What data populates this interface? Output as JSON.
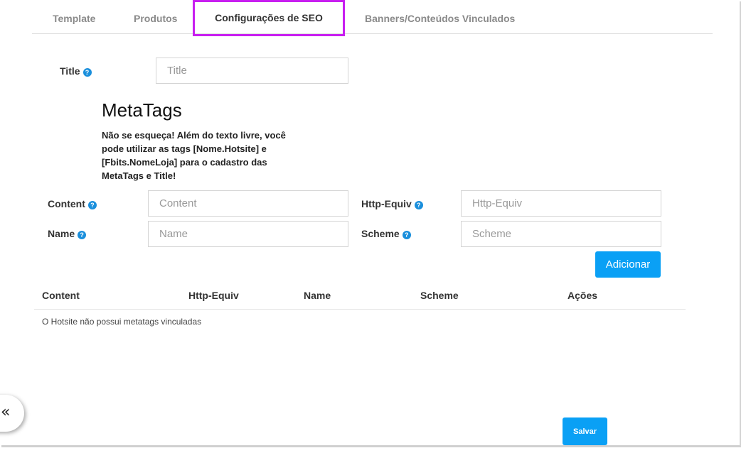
{
  "tabs": [
    {
      "label": "Template"
    },
    {
      "label": "Produtos"
    },
    {
      "label": "Configurações de SEO"
    },
    {
      "label": "Banners/Conteúdos Vinculados"
    }
  ],
  "active_tab_color": "#c81ef0",
  "title_field": {
    "label": "Title",
    "placeholder": "Title",
    "value": ""
  },
  "metatags": {
    "heading": "MetaTags",
    "note": "Não se esqueça! Além do texto livre, você pode utilizar as tags [Nome.Hotsite] e [Fbits.NomeLoja] para o cadastro das MetaTags e Title!"
  },
  "fields": {
    "content": {
      "label": "Content",
      "placeholder": "Content",
      "value": ""
    },
    "http_equiv": {
      "label": "Http-Equiv",
      "placeholder": "Http-Equiv",
      "value": ""
    },
    "name": {
      "label": "Name",
      "placeholder": "Name",
      "value": ""
    },
    "scheme": {
      "label": "Scheme",
      "placeholder": "Scheme",
      "value": ""
    }
  },
  "help_icon": "?",
  "add_button": "Adicionar",
  "table": {
    "headers": [
      "Content",
      "Http-Equiv",
      "Name",
      "Scheme",
      "Ações"
    ],
    "empty_message": "O Hotsite não possui metatags vinculadas"
  },
  "save_button": "Salvar",
  "collapse_icon": "«",
  "accent_color": "#0aa0f5"
}
